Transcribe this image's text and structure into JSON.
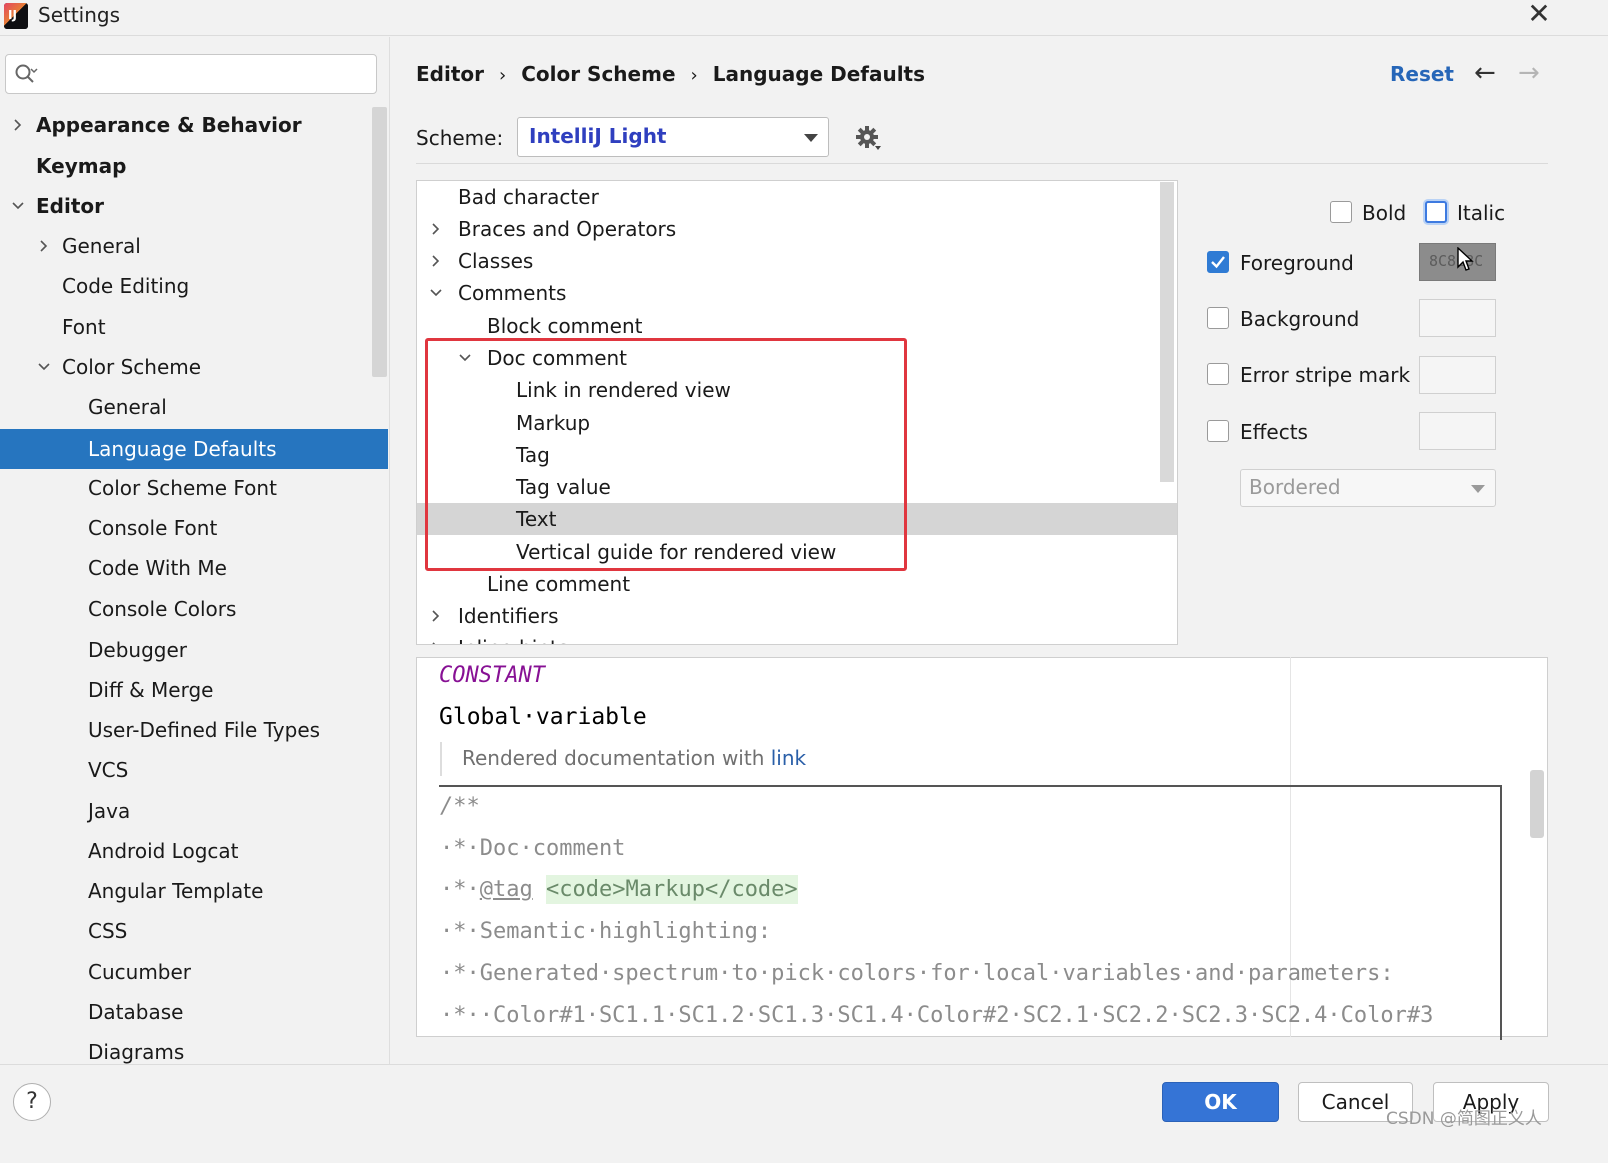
{
  "window": {
    "title": "Settings",
    "close_glyph": "✕"
  },
  "search": {
    "value": "",
    "placeholder": ""
  },
  "sidebar": {
    "items": [
      {
        "label": "Appearance & Behavior"
      },
      {
        "label": "Keymap"
      },
      {
        "label": "Editor"
      },
      {
        "label": "General"
      },
      {
        "label": "Code Editing"
      },
      {
        "label": "Font"
      },
      {
        "label": "Color Scheme"
      },
      {
        "label": "General"
      },
      {
        "label": "Language Defaults",
        "selected": true
      },
      {
        "label": "Color Scheme Font"
      },
      {
        "label": "Console Font"
      },
      {
        "label": "Code With Me"
      },
      {
        "label": "Console Colors"
      },
      {
        "label": "Debugger"
      },
      {
        "label": "Diff & Merge"
      },
      {
        "label": "User-Defined File Types"
      },
      {
        "label": "VCS"
      },
      {
        "label": "Java"
      },
      {
        "label": "Android Logcat"
      },
      {
        "label": "Angular Template"
      },
      {
        "label": "CSS"
      },
      {
        "label": "Cucumber"
      },
      {
        "label": "Database"
      },
      {
        "label": "Diagrams"
      }
    ]
  },
  "breadcrumb": {
    "items": [
      "Editor",
      "Color Scheme",
      "Language Defaults"
    ],
    "separator": "›"
  },
  "header": {
    "reset_label": "Reset",
    "back_glyph": "←",
    "forward_glyph": "→"
  },
  "scheme": {
    "label": "Scheme:",
    "value": "IntelliJ Light"
  },
  "tree": {
    "items": [
      {
        "label": "Bad character"
      },
      {
        "label": "Braces and Operators"
      },
      {
        "label": "Classes"
      },
      {
        "label": "Comments"
      },
      {
        "label": "Block comment"
      },
      {
        "label": "Doc comment"
      },
      {
        "label": "Link in rendered view"
      },
      {
        "label": "Markup"
      },
      {
        "label": "Tag"
      },
      {
        "label": "Tag value"
      },
      {
        "label": "Text",
        "selected": true
      },
      {
        "label": "Vertical guide for rendered view"
      },
      {
        "label": "Line comment"
      },
      {
        "label": "Identifiers"
      },
      {
        "label": "Inline hints"
      }
    ]
  },
  "attributes": {
    "bold_label": "Bold",
    "italic_label": "Italic",
    "foreground_label": "Foreground",
    "foreground_value": "8C8C8C",
    "background_label": "Background",
    "error_stripe_label": "Error stripe mark",
    "effects_label": "Effects",
    "effects_type": "Bordered"
  },
  "preview": {
    "constant": "CONSTANT",
    "global": "Global·variable",
    "rendered_text": "Rendered documentation with ",
    "rendered_link": "link",
    "doc_open": "/**",
    "line_doc_comment": "·*·Doc·comment",
    "line_tag_prefix": "·*·",
    "tag": "@tag",
    "markup_open": "<code>",
    "markup_inner": "Markup",
    "markup_close": "</code>",
    "line_semantic": "·*·Semantic·highlighting:",
    "line_generated": "·*·Generated·spectrum·to·pick·colors·for·local·variables·and·parameters:",
    "line_colors": "·*··Color#1·SC1.1·SC1.2·SC1.3·SC1.4·Color#2·SC2.1·SC2.2·SC2.3·SC2.4·Color#3"
  },
  "footer": {
    "help_label": "?",
    "ok_label": "OK",
    "cancel_label": "Cancel",
    "apply_label": "Apply",
    "watermark": "CSDN @简图正义人"
  },
  "colors": {
    "selection": "#2675bf",
    "link": "#2666b8",
    "highlight_box": "#e0363f",
    "checkbox_checked": "#2f7bd4",
    "foreground_swatch": "#8c8c8c"
  }
}
